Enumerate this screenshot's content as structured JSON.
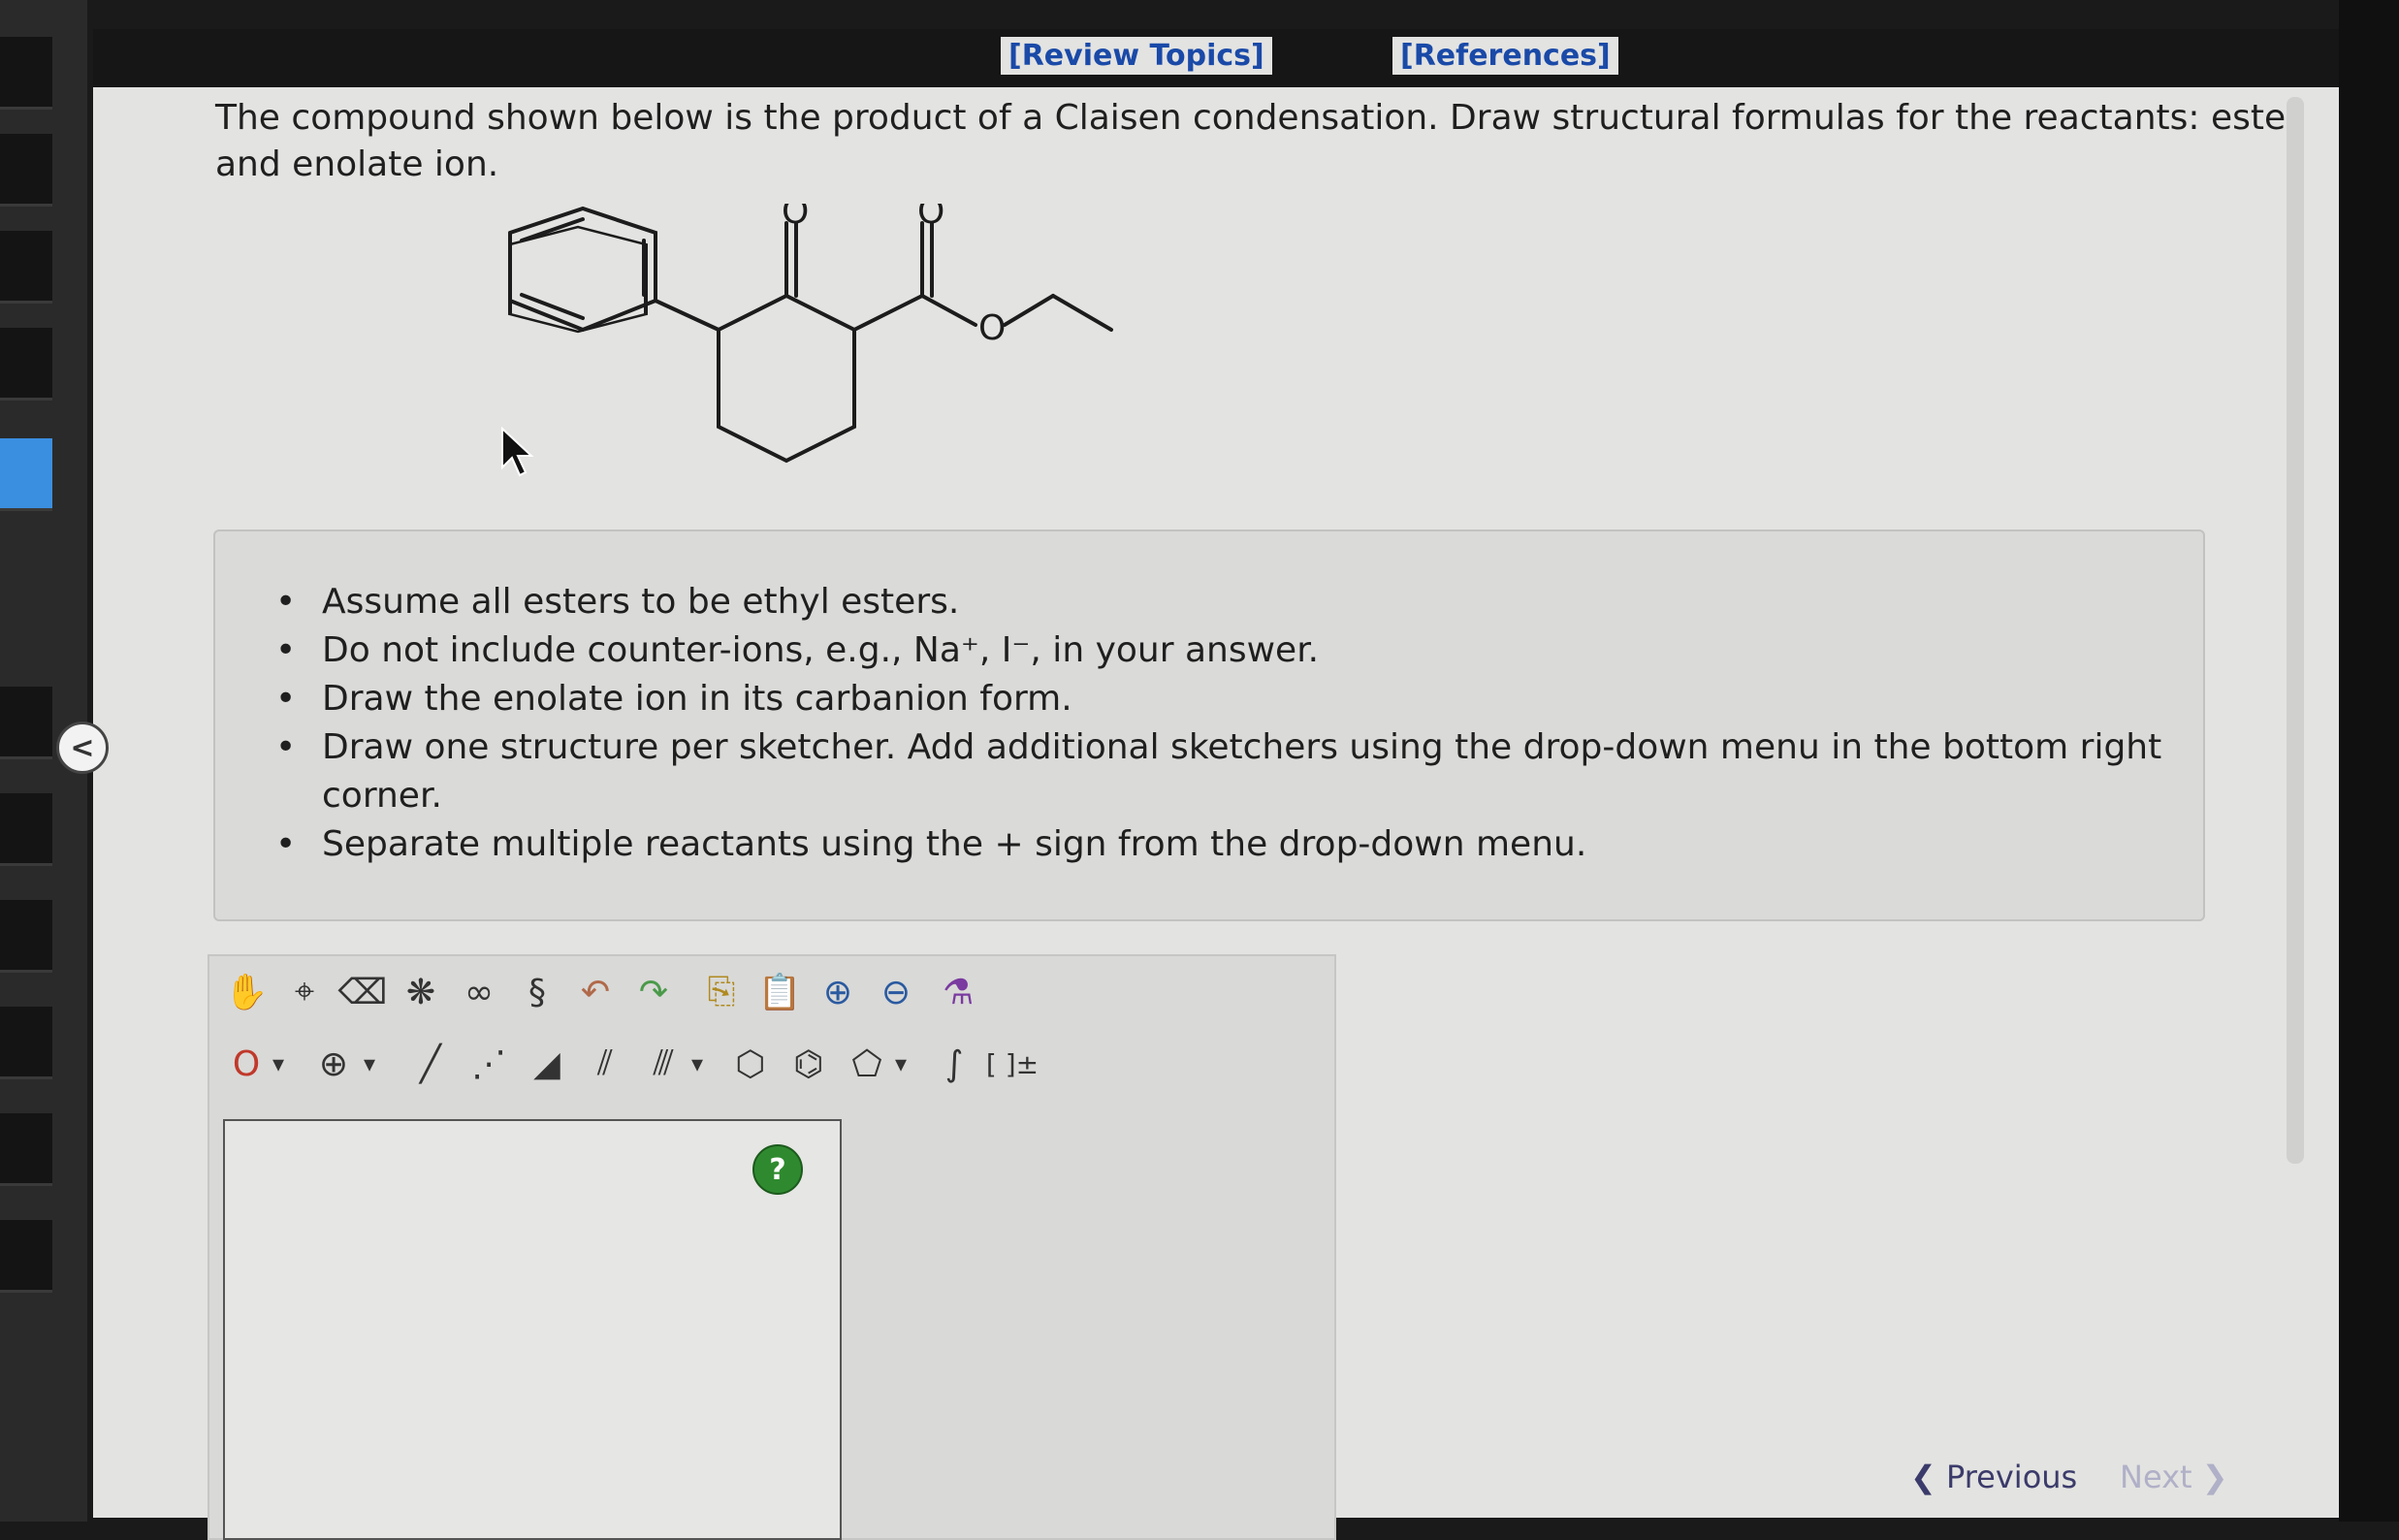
{
  "top_links": {
    "review": "[Review Topics]",
    "references": "[References]"
  },
  "question": {
    "text": "The compound shown below is the product of a Claisen condensation. Draw structural formulas for the reactants: ester and enolate ion."
  },
  "molecule": {
    "o_label": "O"
  },
  "instructions": {
    "items": [
      "Assume all esters to be ethyl esters.",
      "Do not include counter-ions, e.g., Na⁺, I⁻, in your answer.",
      "Draw the enolate ion in its carbanion form.",
      "Draw one structure per sketcher. Add additional sketchers using the drop-down menu in the bottom right corner.",
      "Separate multiple reactants using the + sign from the drop-down menu."
    ]
  },
  "toolbar": {
    "atom_label": "O",
    "dropdown_glyph": "▾",
    "charge_glyph": "⊕",
    "sgroup_label": "[ ]±",
    "help_label": "?"
  },
  "nav": {
    "previous": "Previous",
    "next": "Next"
  },
  "sidebar": {
    "collapse_glyph": "<"
  },
  "colors": {
    "accent": "#3a8fe0",
    "link": "#1a4aa8",
    "help": "#2f8a2f",
    "atom_red": "#c0392b"
  }
}
